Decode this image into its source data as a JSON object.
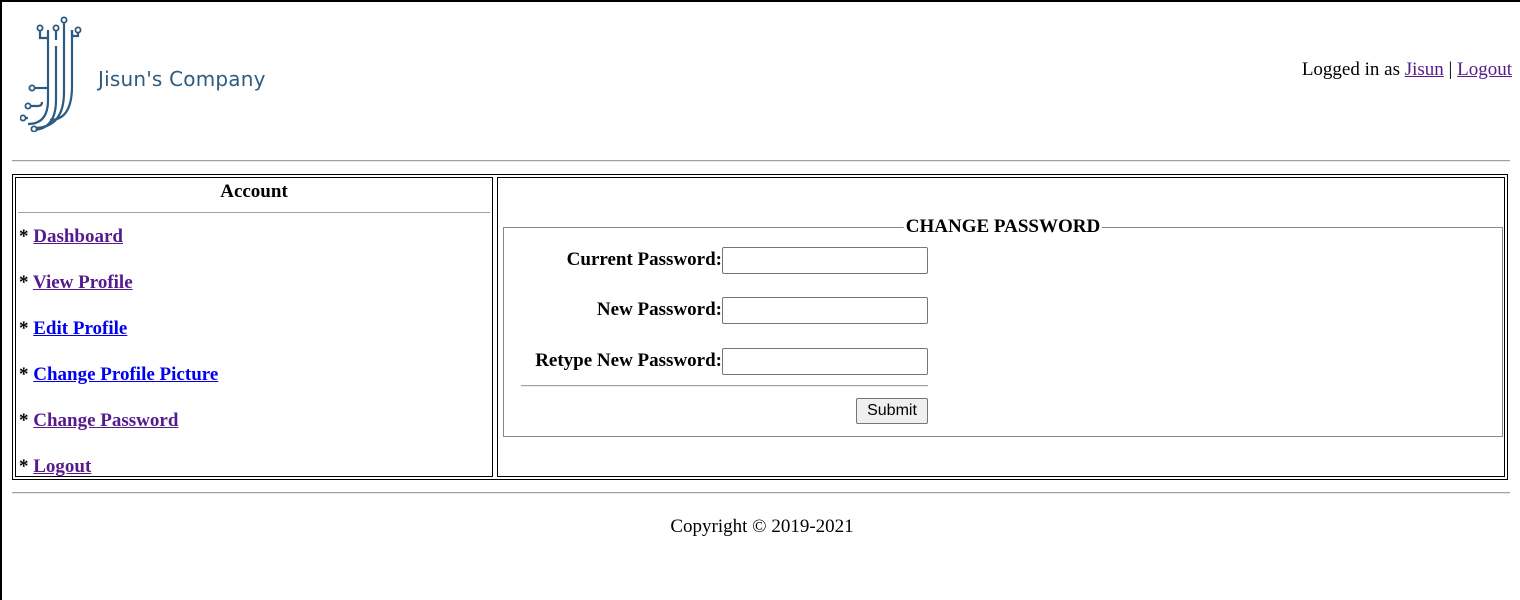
{
  "header": {
    "company_name": "Jisun's Company",
    "logged_in_prefix": "Logged in as",
    "username": "Jisun",
    "separator": "|",
    "logout_label": "Logout"
  },
  "sidebar": {
    "title": "Account",
    "bullet": "*",
    "items": [
      {
        "label": "Dashboard"
      },
      {
        "label": "View Profile"
      },
      {
        "label": "Edit Profile"
      },
      {
        "label": "Change Profile Picture"
      },
      {
        "label": "Change Password"
      },
      {
        "label": "Logout"
      }
    ]
  },
  "form": {
    "legend": "CHANGE PASSWORD",
    "current_password_label": "Current Password:",
    "current_password_value": "",
    "new_password_label": "New Password:",
    "new_password_value": "",
    "retype_password_label": "Retype New Password:",
    "retype_password_value": "",
    "submit_label": "Submit"
  },
  "footer": {
    "copyright": "Copyright © 2019-2021"
  },
  "colors": {
    "link": "#0000ee",
    "visited_link": "#551a8b",
    "logo": "#2e5b80"
  }
}
